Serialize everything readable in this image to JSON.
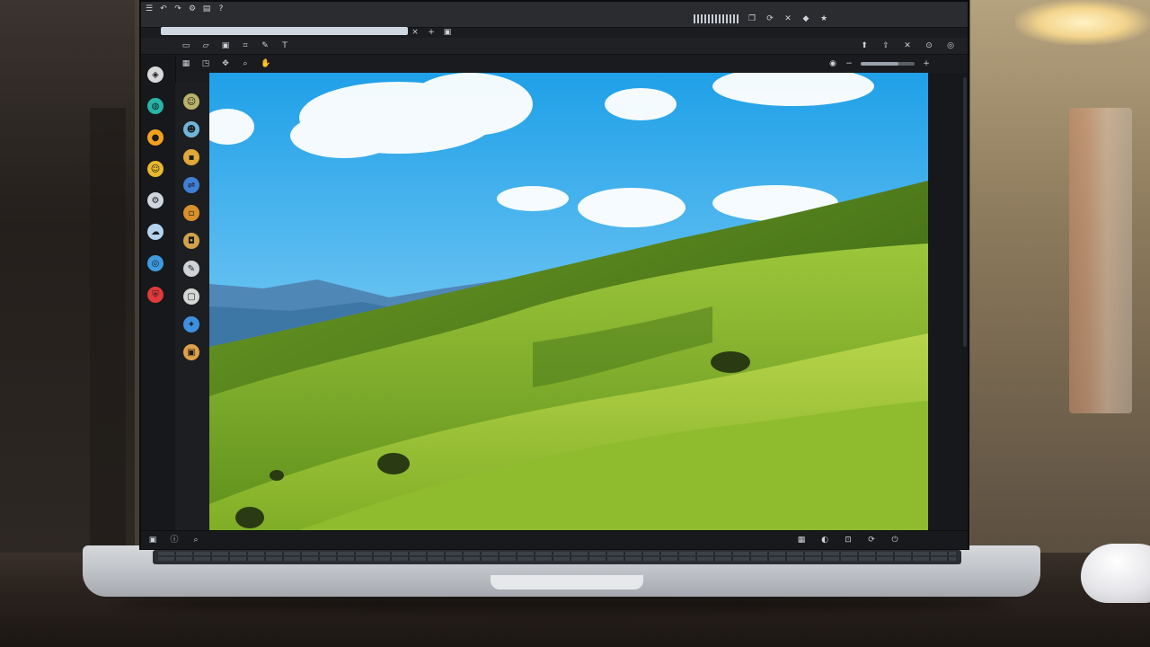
{
  "toolbar": {
    "icons": [
      "menu-icon",
      "undo-icon",
      "redo-icon",
      "settings-icon",
      "layers-icon",
      "help-icon"
    ],
    "right_icons": [
      "window-icon",
      "refresh-icon",
      "close-icon"
    ]
  },
  "addressbar": {
    "text": "",
    "placeholder": ""
  },
  "row2": {
    "items": [
      "file-icon",
      "folder-icon",
      "image-icon",
      "crop-icon",
      "brush-icon",
      "text-icon"
    ],
    "right": [
      "pin-icon",
      "share-icon",
      "maximize-icon",
      "minimize-icon",
      "close-icon"
    ]
  },
  "row3": {
    "items": [
      "grid-icon",
      "select-icon",
      "move-icon",
      "zoom-icon",
      "hand-icon"
    ],
    "zoom_label": "",
    "slider_fill": 0.7
  },
  "rail1": {
    "icons": [
      {
        "name": "app-icon",
        "color": "#d9d9d9"
      },
      {
        "name": "globe-icon",
        "color": "#27b5a8"
      },
      {
        "name": "star-icon",
        "color": "#f2a11c"
      },
      {
        "name": "smile-icon",
        "color": "#e9b82c"
      },
      {
        "name": "settings-icon",
        "color": "#cfd6de"
      },
      {
        "name": "cloud-icon",
        "color": "#b6d3ee"
      },
      {
        "name": "world-icon",
        "color": "#3e9be0"
      },
      {
        "name": "shield-icon",
        "color": "#e03a3a"
      }
    ]
  },
  "rail2": {
    "icons": [
      {
        "name": "smile-icon",
        "color": "#b9b26a"
      },
      {
        "name": "face-icon",
        "color": "#70b5d8"
      },
      {
        "name": "note-icon",
        "color": "#e0a838"
      },
      {
        "name": "share-icon",
        "color": "#3f7fd6"
      },
      {
        "name": "box-icon",
        "color": "#d9902c"
      },
      {
        "name": "bag-icon",
        "color": "#d2a24a"
      },
      {
        "name": "pen-icon",
        "color": "#cfd3d8"
      },
      {
        "name": "frame-icon",
        "color": "#d6d6d6"
      },
      {
        "name": "compass-icon",
        "color": "#3f8fe0"
      },
      {
        "name": "gift-icon",
        "color": "#e0a04a"
      }
    ]
  },
  "statusbar": {
    "left": [
      "layer-icon",
      "info-icon",
      "zoom-icon"
    ],
    "right": [
      "grid-icon",
      "moon-icon",
      "lock-icon",
      "refresh-icon",
      "power-icon"
    ]
  }
}
